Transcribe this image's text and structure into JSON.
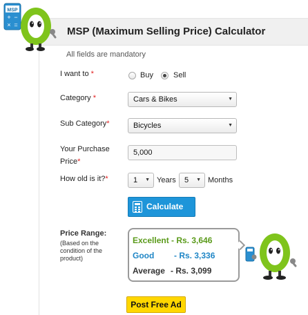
{
  "header": {
    "title": "MSP (Maximum Selling Price) Calculator",
    "note": "All fields are mandatory",
    "badge_label": "MSP"
  },
  "form": {
    "intent": {
      "label": "I want to",
      "required_mark": "*",
      "options": [
        "Buy",
        "Sell"
      ],
      "selected": "Sell"
    },
    "category": {
      "label": "Category",
      "required_mark": "*",
      "value": "Cars & Bikes"
    },
    "sub_category": {
      "label": "Sub Category",
      "required_mark": "*",
      "value": "Bicycles"
    },
    "purchase_price": {
      "label_line1": "Your Purchase",
      "label_line2": "Price",
      "required_mark": "*",
      "value": "5,000"
    },
    "age": {
      "label": "How old is it?",
      "required_mark": "*",
      "years_value": "1",
      "years_unit": "Years",
      "months_value": "5",
      "months_unit": "Months"
    }
  },
  "calculate_button": {
    "label": "Calculate"
  },
  "price_range": {
    "label": "Price Range:",
    "note": "(Based on the condition of the product)",
    "rows": [
      {
        "condition": "Excellent",
        "value": "- Rs. 3,646",
        "color": "#5a9a1a"
      },
      {
        "condition": "Good",
        "value": "- Rs. 3,336",
        "color": "#1f86c6"
      },
      {
        "condition": "Average",
        "value": "- Rs. 3,099",
        "color": "#333333"
      }
    ]
  },
  "post_ad_button": {
    "label": "Post Free Ad"
  },
  "colors": {
    "accent_blue": "#1e95d9",
    "mascot_green": "#7fc41c",
    "post_yellow": "#ffd700",
    "required_red": "#e32020"
  }
}
